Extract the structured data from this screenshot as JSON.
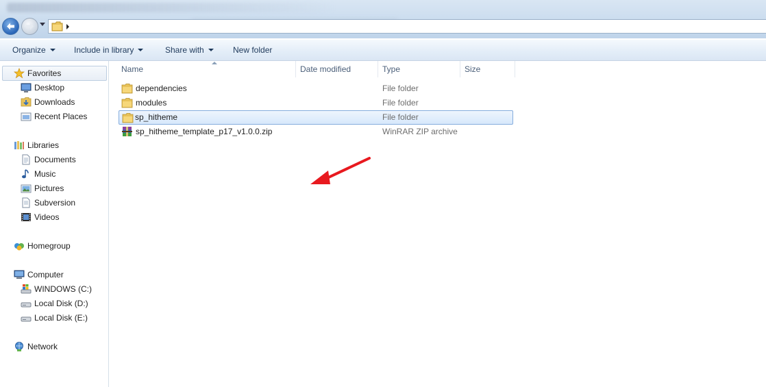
{
  "toolbar": {
    "organize": "Organize",
    "include_in_library": "Include in library",
    "share_with": "Share with",
    "new_folder": "New folder"
  },
  "sidebar": {
    "favorites": {
      "label": "Favorites",
      "items": [
        {
          "label": "Desktop",
          "icon": "desktop-icon"
        },
        {
          "label": "Downloads",
          "icon": "downloads-folder-icon"
        },
        {
          "label": "Recent Places",
          "icon": "recent-places-icon"
        }
      ]
    },
    "libraries": {
      "label": "Libraries",
      "items": [
        {
          "label": "Documents",
          "icon": "documents-icon"
        },
        {
          "label": "Music",
          "icon": "music-icon"
        },
        {
          "label": "Pictures",
          "icon": "pictures-icon"
        },
        {
          "label": "Subversion",
          "icon": "subversion-icon"
        },
        {
          "label": "Videos",
          "icon": "videos-icon"
        }
      ]
    },
    "homegroup": "Homegroup",
    "computer": {
      "label": "Computer",
      "items": [
        {
          "label": "WINDOWS (C:)",
          "icon": "windows-drive-icon"
        },
        {
          "label": "Local Disk (D:)",
          "icon": "disk-drive-icon"
        },
        {
          "label": "Local Disk (E:)",
          "icon": "disk-drive-icon"
        }
      ]
    },
    "network": "Network"
  },
  "columns": {
    "name": "Name",
    "date_modified": "Date modified",
    "type": "Type",
    "size": "Size"
  },
  "files": [
    {
      "name": "dependencies",
      "type": "File folder",
      "icon": "folder-icon",
      "selected": false
    },
    {
      "name": "modules",
      "type": "File folder",
      "icon": "folder-icon",
      "selected": false
    },
    {
      "name": "sp_hitheme",
      "type": "File folder",
      "icon": "folder-icon",
      "selected": true
    },
    {
      "name": "sp_hitheme_template_p17_v1.0.0.zip",
      "type": "WinRAR ZIP archive",
      "icon": "winrar-archive-icon",
      "selected": false
    }
  ],
  "colors": {
    "selection_border": "#84acdd",
    "annotation_arrow": "#e8191f",
    "toolbar_text": "#1e395b"
  }
}
